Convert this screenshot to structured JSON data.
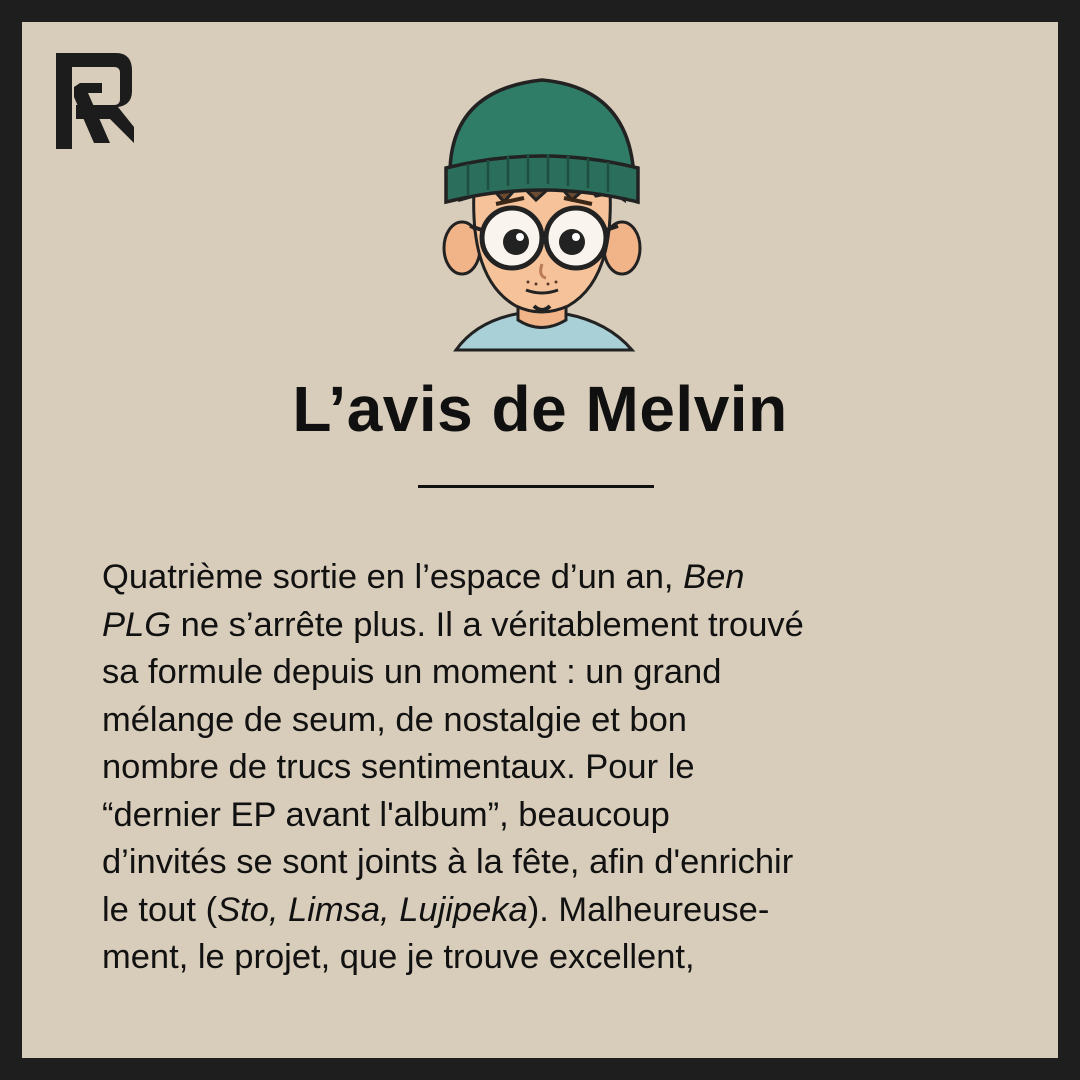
{
  "title": "L’avis de Melvin",
  "logo": {
    "icon": "r-logo-icon",
    "color": "#1c1c1c"
  },
  "colors": {
    "frame": "#1e1e1e",
    "background": "#d8ccba",
    "beanie": "#2f7d67",
    "text": "#111111"
  },
  "body": {
    "l1": "Quatrième sortie en l’espace d’un an, ",
    "l1_italic": "Ben",
    "l2_italic": "PLG",
    "l2": " ne s’arrête plus. Il a véritablement trouvé",
    "l3": "sa formule depuis un moment : un grand",
    "l4": "mélange de seum, de nostalgie et bon",
    "l5": "nombre de trucs sentimentaux. Pour le",
    "l6": "“dernier EP avant l'album”, beaucoup",
    "l7": "d’invités se sont joints à la fête, afin d'enrichir",
    "l8_a": "le tout (",
    "l8_italic": "Sto, Limsa, Lujipeka",
    "l8_b": "). Malheureuse-",
    "l9": "ment, le projet, que je trouve excellent,"
  }
}
